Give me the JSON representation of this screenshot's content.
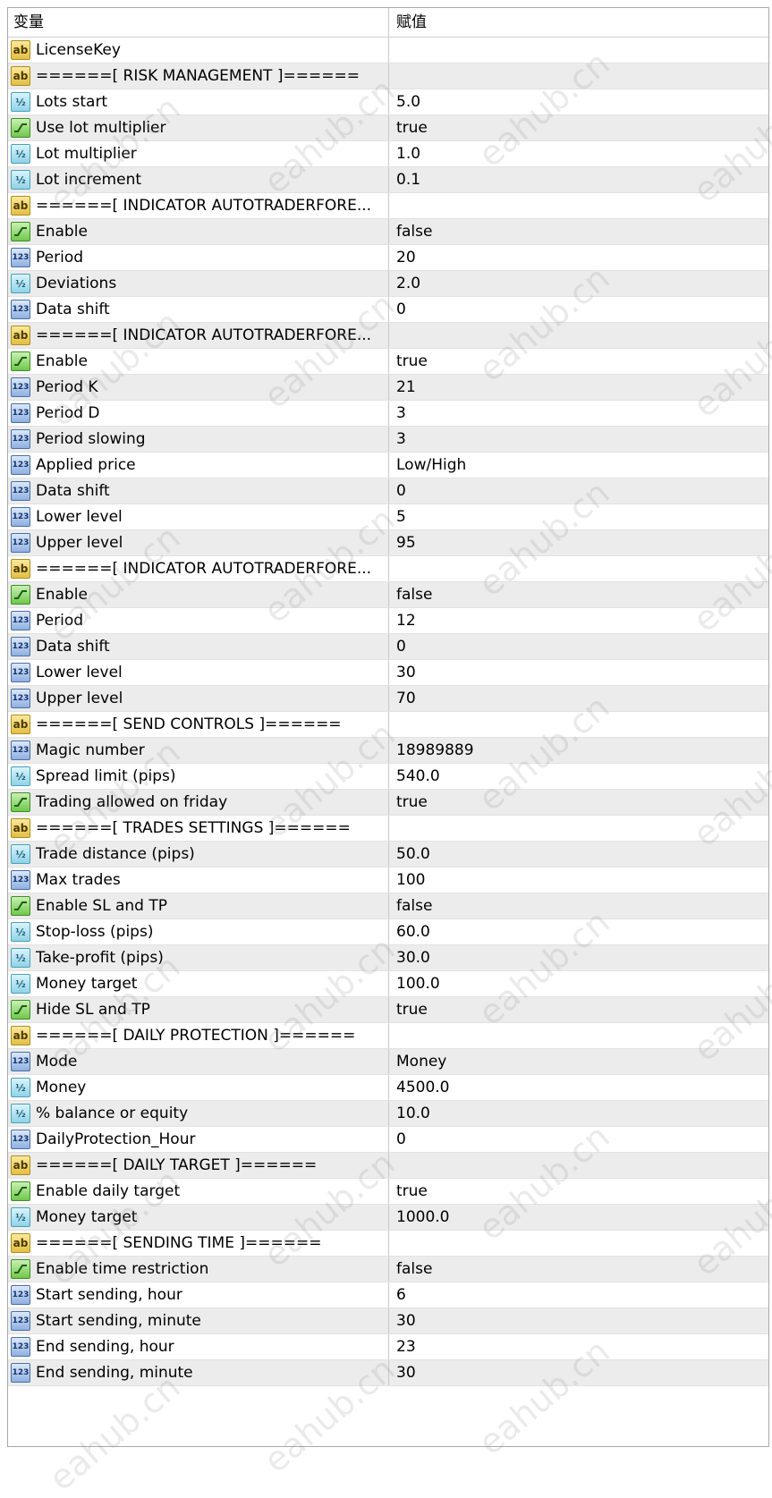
{
  "header": {
    "col_variable": "变量",
    "col_value": "赋值"
  },
  "watermark_text": "eahub.cn",
  "rows": [
    {
      "type": "ab",
      "name": "LicenseKey",
      "value": ""
    },
    {
      "type": "ab",
      "name": "======[ RISK MANAGEMENT ]======",
      "value": ""
    },
    {
      "type": "half",
      "name": "Lots start",
      "value": "5.0"
    },
    {
      "type": "bool",
      "name": "Use lot multiplier",
      "value": "true"
    },
    {
      "type": "half",
      "name": "Lot multiplier",
      "value": "1.0"
    },
    {
      "type": "half",
      "name": "Lot increment",
      "value": "0.1"
    },
    {
      "type": "ab",
      "name": "======[ INDICATOR AUTOTRADERFORE...",
      "value": ""
    },
    {
      "type": "bool",
      "name": "Enable",
      "value": "false"
    },
    {
      "type": "int",
      "name": "Period",
      "value": "20"
    },
    {
      "type": "half",
      "name": "Deviations",
      "value": "2.0"
    },
    {
      "type": "int",
      "name": "Data shift",
      "value": "0"
    },
    {
      "type": "ab",
      "name": "======[ INDICATOR AUTOTRADERFORE...",
      "value": ""
    },
    {
      "type": "bool",
      "name": "Enable",
      "value": "true"
    },
    {
      "type": "int",
      "name": "Period K",
      "value": "21"
    },
    {
      "type": "int",
      "name": "Period D",
      "value": "3"
    },
    {
      "type": "int",
      "name": "Period slowing",
      "value": "3"
    },
    {
      "type": "int",
      "name": "Applied price",
      "value": "Low/High"
    },
    {
      "type": "int",
      "name": "Data shift",
      "value": "0"
    },
    {
      "type": "int",
      "name": "Lower level",
      "value": "5"
    },
    {
      "type": "int",
      "name": "Upper level",
      "value": "95"
    },
    {
      "type": "ab",
      "name": "======[ INDICATOR AUTOTRADERFORE...",
      "value": ""
    },
    {
      "type": "bool",
      "name": "Enable",
      "value": "false"
    },
    {
      "type": "int",
      "name": "Period",
      "value": "12"
    },
    {
      "type": "int",
      "name": "Data shift",
      "value": "0"
    },
    {
      "type": "int",
      "name": "Lower level",
      "value": "30"
    },
    {
      "type": "int",
      "name": "Upper level",
      "value": "70"
    },
    {
      "type": "ab",
      "name": "======[ SEND CONTROLS ]======",
      "value": ""
    },
    {
      "type": "int",
      "name": "Magic number",
      "value": "18989889"
    },
    {
      "type": "half",
      "name": "Spread limit (pips)",
      "value": "540.0"
    },
    {
      "type": "bool",
      "name": "Trading allowed on friday",
      "value": "true"
    },
    {
      "type": "ab",
      "name": "======[ TRADES SETTINGS ]======",
      "value": ""
    },
    {
      "type": "half",
      "name": "Trade distance (pips)",
      "value": "50.0"
    },
    {
      "type": "int",
      "name": "Max trades",
      "value": "100"
    },
    {
      "type": "bool",
      "name": "Enable SL and TP",
      "value": "false"
    },
    {
      "type": "half",
      "name": "Stop-loss (pips)",
      "value": "60.0"
    },
    {
      "type": "half",
      "name": "Take-profit (pips)",
      "value": "30.0"
    },
    {
      "type": "half",
      "name": "Money target",
      "value": "100.0"
    },
    {
      "type": "bool",
      "name": "Hide SL and TP",
      "value": "true"
    },
    {
      "type": "ab",
      "name": "======[ DAILY PROTECTION ]======",
      "value": ""
    },
    {
      "type": "int",
      "name": "Mode",
      "value": "Money"
    },
    {
      "type": "half",
      "name": "Money",
      "value": "4500.0"
    },
    {
      "type": "half",
      "name": "% balance or equity",
      "value": "10.0"
    },
    {
      "type": "int",
      "name": "DailyProtection_Hour",
      "value": "0"
    },
    {
      "type": "ab",
      "name": "======[ DAILY TARGET ]======",
      "value": ""
    },
    {
      "type": "bool",
      "name": "Enable daily target",
      "value": "true"
    },
    {
      "type": "half",
      "name": "Money target",
      "value": "1000.0"
    },
    {
      "type": "ab",
      "name": "======[ SENDING TIME ]======",
      "value": ""
    },
    {
      "type": "bool",
      "name": "Enable time restriction",
      "value": "false"
    },
    {
      "type": "int",
      "name": "Start sending, hour",
      "value": "6"
    },
    {
      "type": "int",
      "name": "Start sending, minute",
      "value": "30"
    },
    {
      "type": "int",
      "name": "End sending, hour",
      "value": "23"
    },
    {
      "type": "int",
      "name": "End sending, minute",
      "value": "30"
    }
  ]
}
